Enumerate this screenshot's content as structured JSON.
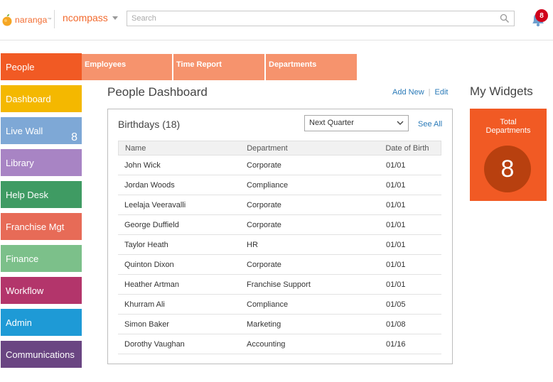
{
  "header": {
    "logo_text": "naranga",
    "logo_tm": "™",
    "brand": "ncompass",
    "search_placeholder": "Search",
    "notifications_count": "8"
  },
  "sidebar": {
    "items": [
      {
        "label": "People",
        "color": "#f15a24"
      },
      {
        "label": "Dashboard",
        "color": "#f4b800"
      },
      {
        "label": "Live Wall",
        "count": "8",
        "color": "#7ea8d6"
      },
      {
        "label": "Library",
        "color": "#a884c4"
      },
      {
        "label": "Help Desk",
        "color": "#3f9b63"
      },
      {
        "label": "Franchise Mgt",
        "color": "#e76b57"
      },
      {
        "label": "Finance",
        "color": "#7cc08a"
      },
      {
        "label": "Workflow",
        "color": "#b3356b"
      },
      {
        "label": "Admin",
        "color": "#1e9ad6"
      },
      {
        "label": "Communications",
        "color": "#6a4582"
      }
    ]
  },
  "tabs": [
    {
      "label": "Employees"
    },
    {
      "label": "Time Report"
    },
    {
      "label": "Departments"
    }
  ],
  "page": {
    "title": "People Dashboard",
    "add_new": "Add New",
    "separator": "|",
    "edit": "Edit"
  },
  "birthdays": {
    "title": "Birthdays (18)",
    "filter_value": "Next Quarter",
    "see_all": "See All",
    "columns": [
      "Name",
      "Department",
      "Date of Birth"
    ],
    "rows": [
      [
        "John Wick",
        "Corporate",
        "01/01"
      ],
      [
        "Jordan Woods",
        "Compliance",
        "01/01"
      ],
      [
        "Leelaja Veeravalli",
        "Corporate",
        "01/01"
      ],
      [
        "George Duffield",
        "Corporate",
        "01/01"
      ],
      [
        "Taylor Heath",
        "HR",
        "01/01"
      ],
      [
        "Quinton Dixon",
        "Corporate",
        "01/01"
      ],
      [
        "Heather Artman",
        "Franchise Support",
        "01/01"
      ],
      [
        "Khurram Ali",
        "Compliance",
        "01/05"
      ],
      [
        "Simon Baker",
        "Marketing",
        "01/08"
      ],
      [
        "Dorothy Vaughan",
        "Accounting",
        "01/16"
      ]
    ]
  },
  "widgets": {
    "title": "My Widgets",
    "items": [
      {
        "label_line1": "Total",
        "label_line2": "Departments",
        "value": "8",
        "color": "#f15a24"
      }
    ]
  }
}
